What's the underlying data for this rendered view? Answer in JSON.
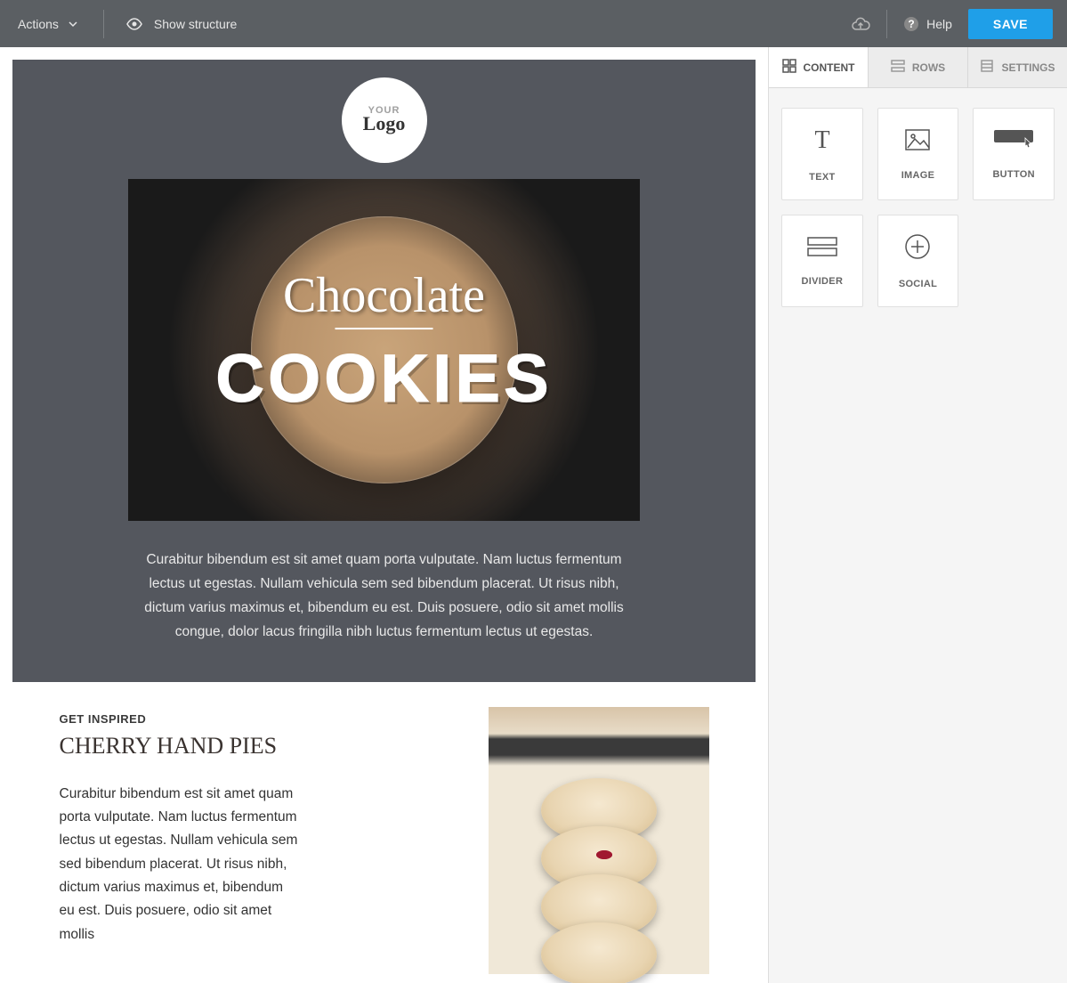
{
  "toolbar": {
    "actions_label": "Actions",
    "show_structure_label": "Show structure",
    "help_label": "Help",
    "save_label": "SAVE"
  },
  "sidebar": {
    "tabs": {
      "content": "CONTENT",
      "rows": "ROWS",
      "settings": "SETTINGS"
    },
    "blocks": {
      "text": "TEXT",
      "image": "IMAGE",
      "button": "BUTTON",
      "divider": "DIVIDER",
      "social": "SOCIAL"
    }
  },
  "template": {
    "logo": {
      "top": "YOUR",
      "bottom": "Logo"
    },
    "hero": {
      "script": "Chocolate",
      "big": "COOKIES",
      "body": "Curabitur bibendum est sit amet quam porta vulputate. Nam luctus fermentum lectus ut egestas. Nullam vehicula sem sed bibendum placerat. Ut risus nibh, dictum varius maximus et, bibendum eu est. Duis posuere, odio sit amet mollis congue, dolor lacus fringilla nibh luctus fermentum lectus ut egestas."
    },
    "section2": {
      "eyebrow": "GET INSPIRED",
      "title": "CHERRY HAND PIES",
      "body": "Curabitur bibendum est sit amet quam porta vulputate. Nam luctus fermentum lectus ut egestas. Nullam vehicula sem sed bibendum placerat. Ut risus nibh, dictum varius maximus et, bibendum eu est. Duis posuere, odio sit amet mollis"
    }
  }
}
